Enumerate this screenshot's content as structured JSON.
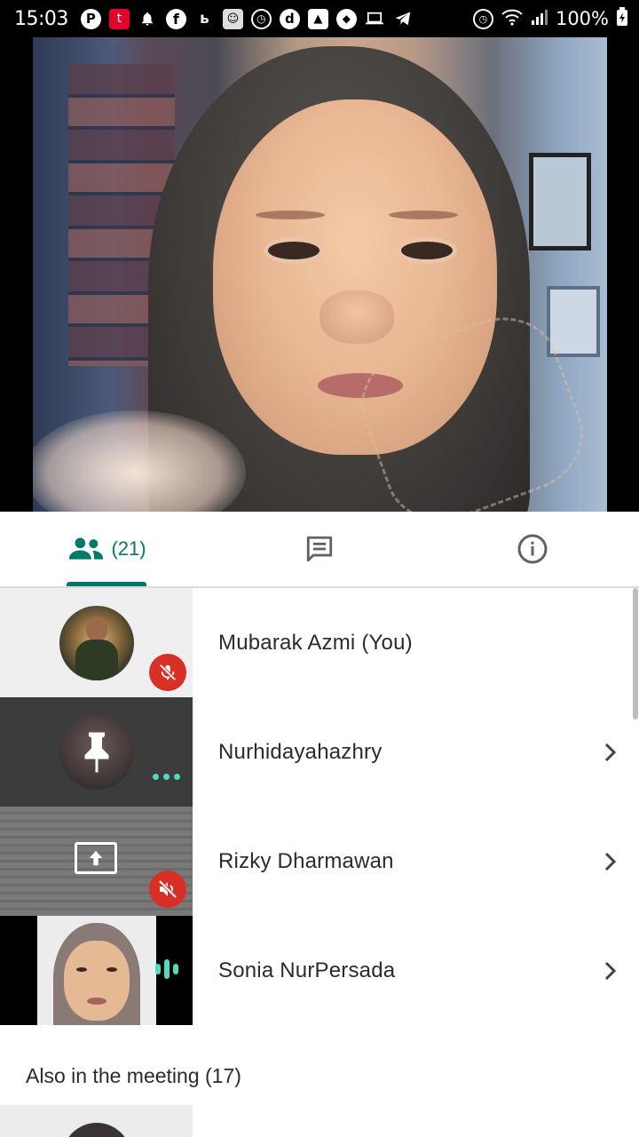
{
  "status_bar": {
    "time": "15:03",
    "battery": "100%",
    "notification_icons": [
      "pinterest-icon",
      "telkomsel-icon",
      "bell-icon",
      "facebook-icon",
      "app-icon",
      "game-icon",
      "alarm-icon",
      "dana-icon",
      "gallery-icon",
      "messenger-icon",
      "laptop-icon",
      "telegram-icon"
    ]
  },
  "tabs": {
    "people_count": "(21)",
    "active": "people"
  },
  "participants": [
    {
      "name": "Mubarak Azmi (You)",
      "status": "muted",
      "has_chevron": false
    },
    {
      "name": "Nurhidayahazhry",
      "status": "pinned",
      "has_chevron": true
    },
    {
      "name": "Rizky Dharmawan",
      "status": "presenting-muted",
      "has_chevron": true
    },
    {
      "name": "Sonia NurPersada",
      "status": "speaking",
      "has_chevron": true
    }
  ],
  "also_in_meeting": {
    "title": "Also in the meeting (17)"
  },
  "colors": {
    "accent": "#00796b",
    "muted_red": "#d93025",
    "speaking": "#4ddbc4"
  }
}
